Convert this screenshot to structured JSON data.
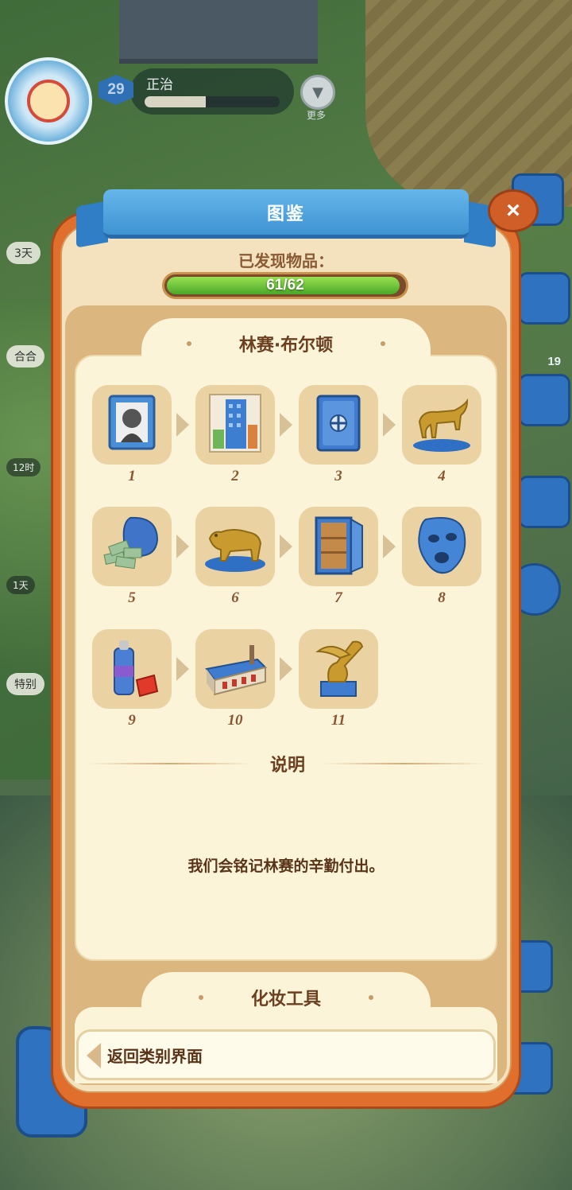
{
  "player": {
    "level": "29",
    "name": "正治",
    "xp_progress": 0.45,
    "more_label": "更多"
  },
  "side": {
    "left_chips": [
      "3天",
      "合合",
      "12时",
      "1天",
      "特别"
    ],
    "right_badge": "19"
  },
  "modal": {
    "title": "图鉴",
    "close_label": "×",
    "found_label": "已发现物品：",
    "progress_text": "61/62",
    "progress_value": 0.984,
    "collection": {
      "title": "林赛·布尔顿",
      "items": [
        {
          "num": "1",
          "icon": "portrait-frame-icon"
        },
        {
          "num": "2",
          "icon": "skyscraper-picture-icon"
        },
        {
          "num": "3",
          "icon": "safe-icon"
        },
        {
          "num": "4",
          "icon": "golden-bull-icon"
        },
        {
          "num": "5",
          "icon": "money-bag-icon"
        },
        {
          "num": "6",
          "icon": "golden-bear-icon"
        },
        {
          "num": "7",
          "icon": "open-cabinet-icon"
        },
        {
          "num": "8",
          "icon": "mask-icon"
        },
        {
          "num": "9",
          "icon": "spray-can-icon"
        },
        {
          "num": "10",
          "icon": "factory-icon"
        },
        {
          "num": "11",
          "icon": "golden-trophy-icon"
        }
      ],
      "desc_title": "说明",
      "desc_text": "我们会铭记林赛的辛勤付出。"
    },
    "next_collection": {
      "title": "化妆工具"
    },
    "back_label": "返回类别界面"
  }
}
